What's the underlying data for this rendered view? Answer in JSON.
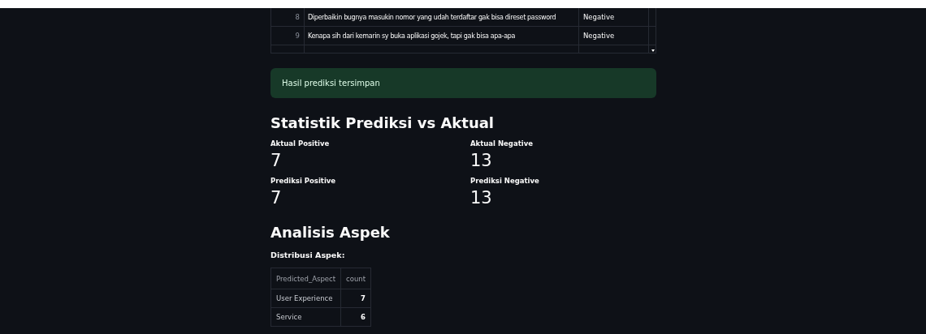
{
  "review_table": {
    "rows": [
      {
        "index": "8",
        "text": "Diperbaikin bugnya masukin nomor yang udah terdaftar gak bisa direset password",
        "sentiment": "Negative"
      },
      {
        "index": "9",
        "text": "Kenapa sih dari kemarin sy buka aplikasi gojek, tapi gak bisa apa-apa",
        "sentiment": "Negative"
      }
    ]
  },
  "success_message": "Hasil prediksi tersimpan",
  "stats_heading": "Statistik Prediksi vs Aktual",
  "metrics": [
    {
      "label": "Aktual Positive",
      "value": "7"
    },
    {
      "label": "Aktual Negative",
      "value": "13"
    },
    {
      "label": "Prediksi Positive",
      "value": "7"
    },
    {
      "label": "Prediksi Negative",
      "value": "13"
    }
  ],
  "aspect_heading": "Analisis Aspek",
  "aspect_subheading": "Distribusi Aspek:",
  "aspect_table": {
    "columns": [
      "Predicted_Aspect",
      "count"
    ],
    "rows": [
      [
        "User Experience",
        "7"
      ],
      [
        "Service",
        "6"
      ]
    ]
  }
}
